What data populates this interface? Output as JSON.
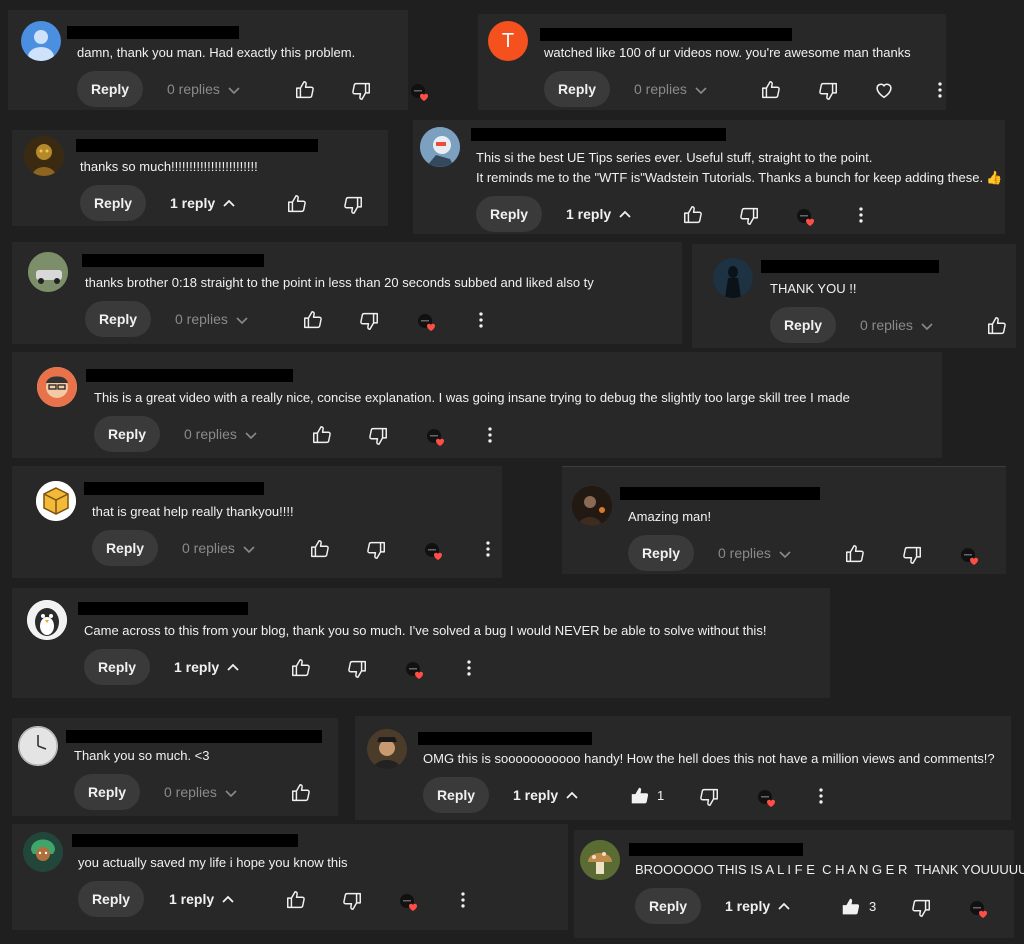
{
  "actions": {
    "reply_label": "Reply"
  },
  "comments": [
    {
      "avatar": "person-default",
      "text": "damn, thank you man. Had exactly this problem.",
      "replies": "0 replies"
    },
    {
      "avatar": "letter",
      "avatar_letter": "T",
      "avatar_color": "#f4511e",
      "text": "watched like 100 of ur videos now. you're awesome man thanks",
      "replies": "0 replies"
    },
    {
      "avatar": "figure-gold",
      "text": "thanks so much!!!!!!!!!!!!!!!!!!!!!!!!",
      "replies": "1 reply"
    },
    {
      "avatar": "robot",
      "text_lines": [
        "This si the best UE Tips series ever. Useful stuff, straight to the point.",
        "It reminds me to the \"WTF is\"Wadstein Tutorials. Thanks a bunch for keep adding these."
      ],
      "emoji": "👍",
      "replies": "1 reply"
    },
    {
      "avatar": "car",
      "text": "thanks brother 0:18 straight to the point in less than 20 seconds subbed and liked also ty",
      "replies": "0 replies"
    },
    {
      "avatar": "dark-figure",
      "text": "THANK YOU !!",
      "replies": "0 replies"
    },
    {
      "avatar": "man-glasses",
      "text": "This is a great video with a really nice, concise explanation. I was going insane trying to debug the slightly too large skill tree I made",
      "replies": "0 replies"
    },
    {
      "avatar": "box",
      "text": "that is great help really thankyou!!!!",
      "replies": "0 replies"
    },
    {
      "avatar": "dark-photo",
      "text": "Amazing man!",
      "replies": "0 replies"
    },
    {
      "avatar": "penguin",
      "text": "Came across to this from your blog, thank you so much. I've solved a bug I would NEVER be able to solve without this!",
      "replies": "1 reply"
    },
    {
      "avatar": "clock",
      "text": "Thank you so much. <3",
      "replies": "0 replies"
    },
    {
      "avatar": "man-cap",
      "text": "OMG this is sooooooooooo handy! How the hell does this not have a million views and comments!?",
      "replies": "1 reply",
      "likes": "1"
    },
    {
      "avatar": "green-hair",
      "text": "you actually saved my life i hope you know this",
      "replies": "1 reply"
    },
    {
      "avatar": "mushroom",
      "text": "BROOOOOO THIS IS A L I F E  C H A N G E R  THANK YOUUUUU",
      "replies": "1 reply",
      "likes": "3"
    }
  ],
  "icons": {
    "like": "thumbs-up-icon",
    "dislike": "thumbs-down-icon",
    "heart": "heart-icon",
    "more": "more-vert-icon",
    "creator_heart": "creator-heart-badge",
    "expand": "chevron-down-icon",
    "collapse": "chevron-up-icon"
  },
  "colors": {
    "background": "#1f1f1f",
    "card": "#282828",
    "reply_button": "#3a3a3a",
    "heart": "#ff4e45",
    "muted": "#8a8a8a"
  }
}
